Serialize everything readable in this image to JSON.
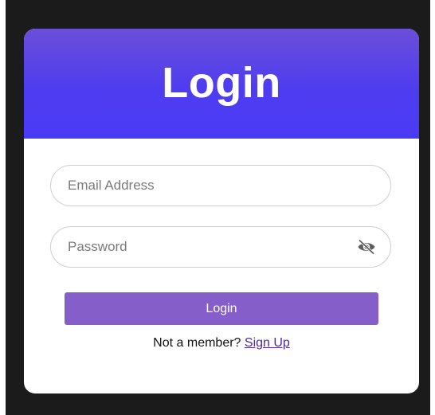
{
  "header": {
    "title": "Login"
  },
  "form": {
    "email": {
      "placeholder": "Email Address",
      "value": ""
    },
    "password": {
      "placeholder": "Password",
      "value": "",
      "toggle_icon": "eye-slash-icon"
    },
    "submit_label": "Login"
  },
  "footer": {
    "prompt": "Not a member?",
    "link_label": "Sign Up"
  },
  "colors": {
    "header_top": "#6a4fd9",
    "header_bottom": "#4b3bf6",
    "button": "#865ec9",
    "link": "#4b2aa8",
    "background": "#1b1b1b"
  }
}
